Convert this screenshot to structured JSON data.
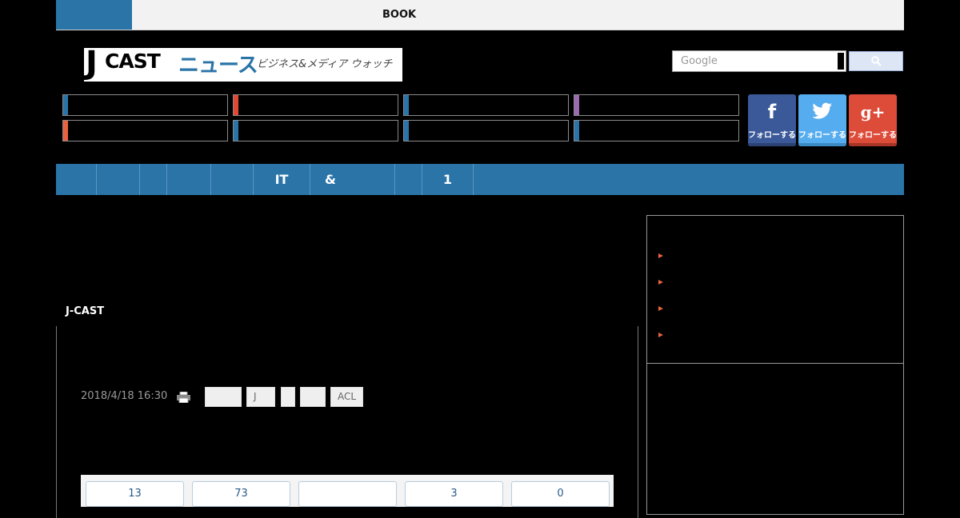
{
  "topbar": {
    "book_label": "BOOK"
  },
  "logo": {
    "j": "J",
    "cast": "CAST",
    "news": "ニュース",
    "tagline": "ビジネス&メディア ウォッチ"
  },
  "search": {
    "placeholder": "Google",
    "button_icon": "search-icon"
  },
  "categories": {
    "row1_colors": [
      "#2a74a8",
      "#e04a35",
      "#2a74a8",
      "#9b6bb0"
    ],
    "row2_colors": [
      "#e8623f",
      "#2a74a8",
      "#2a74a8",
      "#2a74a8"
    ]
  },
  "social": {
    "facebook": {
      "icon": "f",
      "label": "フォローする",
      "color": "#3b5998"
    },
    "twitter": {
      "icon": "twitter-bird",
      "label": "フォローする",
      "color": "#55acee"
    },
    "googleplus": {
      "icon": "g+",
      "label": "フォローする",
      "color": "#dd4b39"
    }
  },
  "mainnav": {
    "items": [
      "",
      "",
      "",
      "",
      "",
      "IT",
      "&",
      "",
      "1"
    ]
  },
  "article": {
    "source": "J-CAST",
    "date": "2018/4/18 16:30",
    "tags": [
      "",
      "J",
      "",
      "",
      "ACL"
    ]
  },
  "reactions": [
    "13",
    "73",
    "",
    "3",
    "0"
  ],
  "colors": {
    "accent": "#2a74a8",
    "bullet": "#e8623f"
  }
}
